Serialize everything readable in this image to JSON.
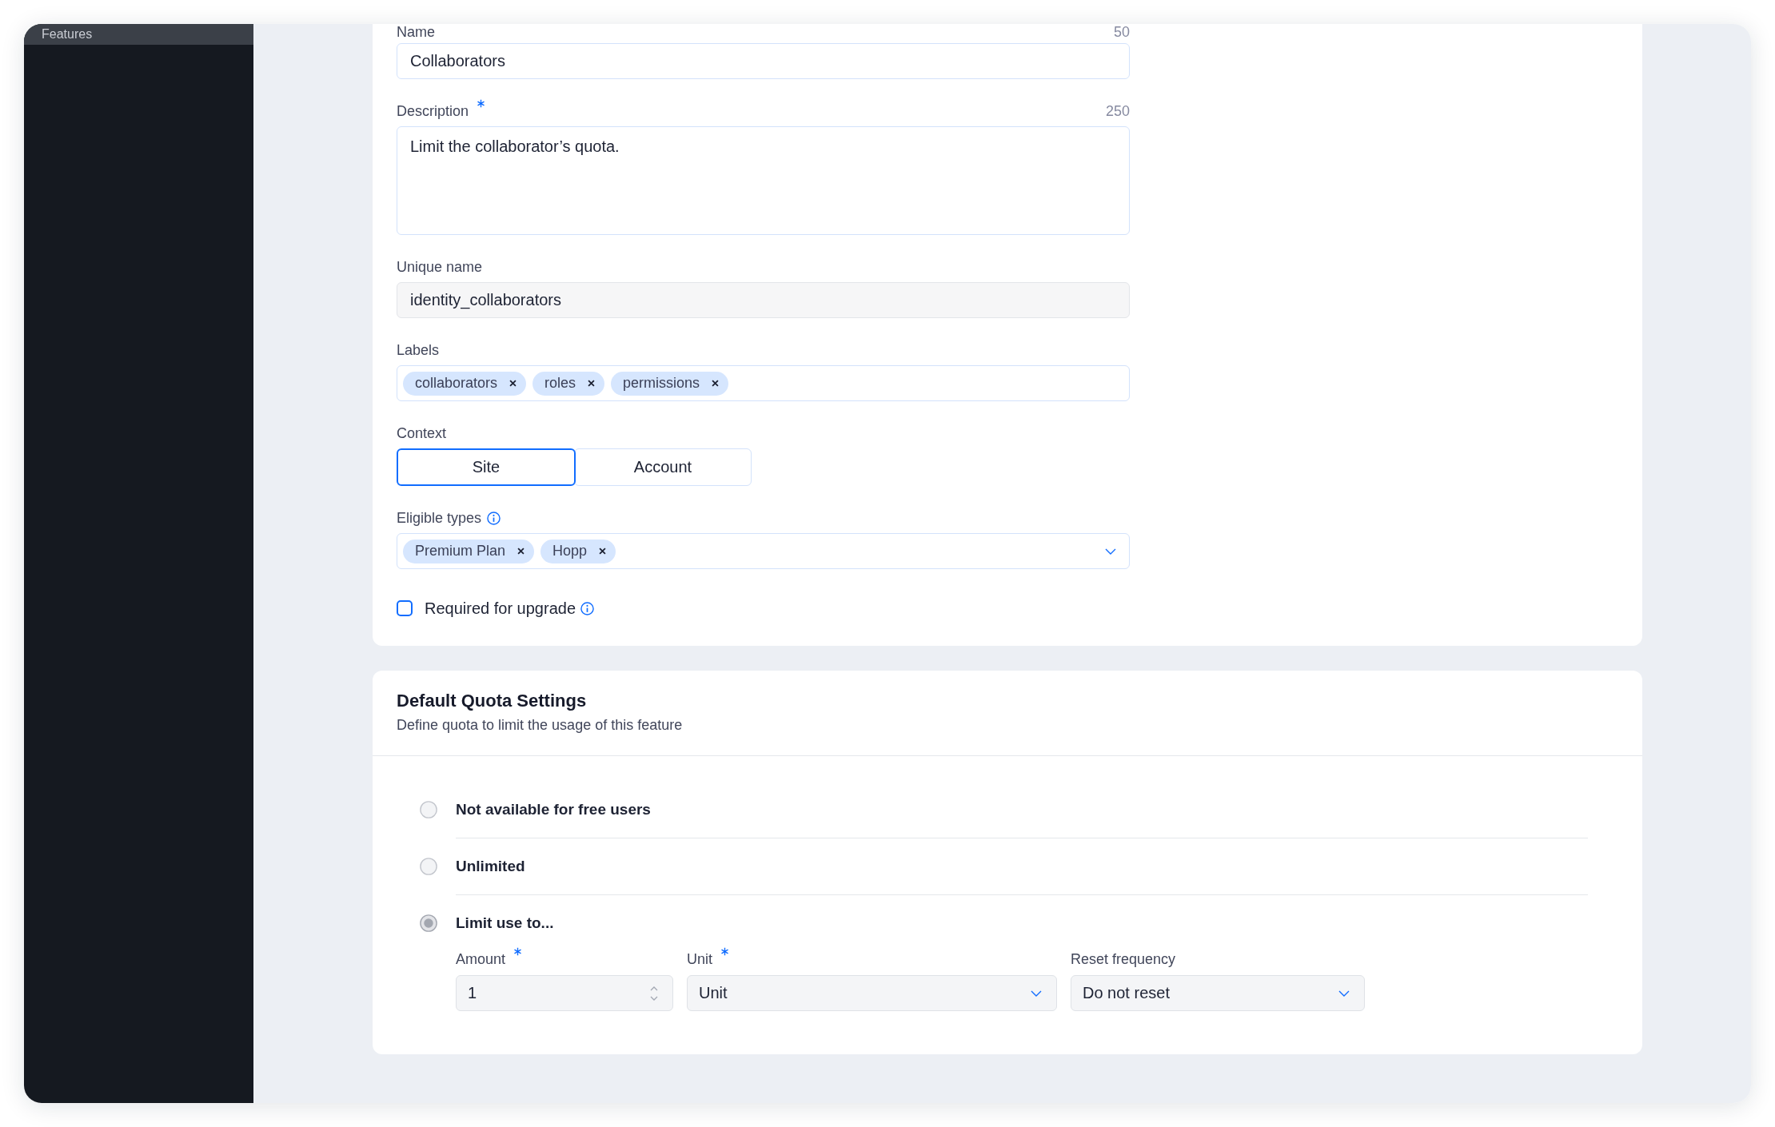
{
  "sidebar": {
    "items": [
      {
        "label": "Features",
        "selected": true
      }
    ]
  },
  "feature_form": {
    "name": {
      "label": "Name",
      "counter": "50",
      "value": "Collaborators"
    },
    "description": {
      "label": "Description",
      "required": true,
      "counter": "250",
      "value": "Limit the collaborator’s quota."
    },
    "unique_name": {
      "label": "Unique name",
      "value": "identity_collaborators",
      "disabled": true
    },
    "labels": {
      "label": "Labels",
      "tags": [
        "collaborators",
        "roles",
        "permissions"
      ]
    },
    "context": {
      "label": "Context",
      "options": [
        {
          "label": "Site",
          "selected": true
        },
        {
          "label": "Account",
          "selected": false
        }
      ]
    },
    "eligible_types": {
      "label": "Eligible types",
      "info": true,
      "tags": [
        "Premium Plan",
        "Hopp"
      ]
    },
    "required_for_upgrade": {
      "label": "Required for upgrade",
      "info": true,
      "checked": false
    }
  },
  "quota_settings": {
    "title": "Default Quota Settings",
    "subtitle": "Define quota to limit the usage of this feature",
    "options": [
      {
        "label": "Not available for free users",
        "selected": false
      },
      {
        "label": "Unlimited",
        "selected": false
      },
      {
        "label": "Limit use to...",
        "selected": true,
        "fields": [
          {
            "kind": "number",
            "label": "Amount",
            "required": true,
            "value": "1",
            "disabled": true
          },
          {
            "kind": "select",
            "label": "Unit",
            "required": true,
            "value": "Unit",
            "disabled": true
          },
          {
            "kind": "select",
            "label": "Reset frequency",
            "required": false,
            "value": "Do not reset",
            "disabled": true
          }
        ]
      }
    ]
  }
}
